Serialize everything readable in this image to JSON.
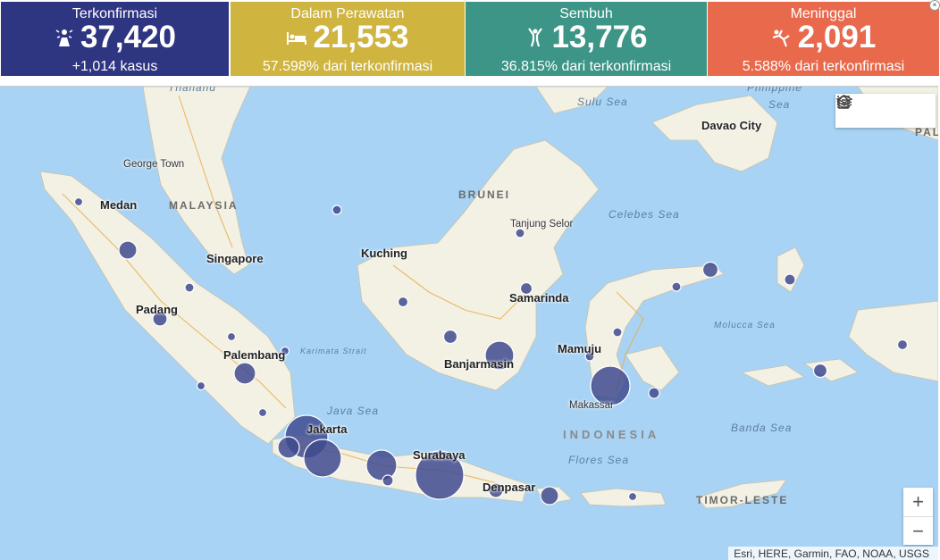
{
  "stats": {
    "confirmed": {
      "title": "Terkonfirmasi",
      "value": "37,420",
      "sub": "+1,014 kasus",
      "icon": "virus-person-icon"
    },
    "treated": {
      "title": "Dalam Perawatan",
      "value": "21,553",
      "sub": "57.598% dari terkonfirmasi",
      "icon": "hospital-bed-icon"
    },
    "recovered": {
      "title": "Sembuh",
      "value": "13,776",
      "sub": "36.815% dari terkonfirmasi",
      "icon": "celebrating-person-icon"
    },
    "deaths": {
      "title": "Meninggal",
      "value": "2,091",
      "sub": "5.588% dari terkonfirmasi",
      "icon": "falling-person-icon"
    }
  },
  "map": {
    "cities": {
      "medan": "Medan",
      "george_town": "George Town",
      "singapore": "Singapore",
      "padang": "Padang",
      "palembang": "Palembang",
      "jakarta": "Jakarta",
      "surabaya": "Surabaya",
      "denpasar": "Denpasar",
      "kuching": "Kuching",
      "banjarmasin": "Banjarmasin",
      "samarinda": "Samarinda",
      "tanjung_selor": "Tanjung Selor",
      "mamuju": "Mamuju",
      "makassar": "Makassar",
      "davao": "Davao City"
    },
    "countries": {
      "malaysia": "MALAYSIA",
      "brunei": "BRUNEI",
      "indonesia": "INDONESIA",
      "timor": "TIMOR-LESTE",
      "thailand": "Thailand",
      "philippine": "Philippine",
      "pal": "PAL"
    },
    "seas": {
      "sulu": "Sulu Sea",
      "celebes": "Celebes Sea",
      "java": "Java Sea",
      "flores": "Flores Sea",
      "banda": "Banda Sea",
      "molucca": "Molucca Sea",
      "karimata": "Karimata Strait",
      "sea_ph": "Sea"
    },
    "attribution": "Esri, HERE, Garmin, FAO, NOAA, USGS",
    "toolbar": {
      "home": "home-icon",
      "legend": "list-icon",
      "layers": "layers-icon"
    },
    "zoom": {
      "in": "+",
      "out": "−"
    }
  },
  "colors": {
    "confirmed": "#2e3581",
    "treated": "#cfb440",
    "recovered": "#3c9586",
    "deaths": "#e9694c",
    "bubble": "#3f4a8f",
    "land": "#f3f0e4",
    "water": "#a8d3f4"
  }
}
